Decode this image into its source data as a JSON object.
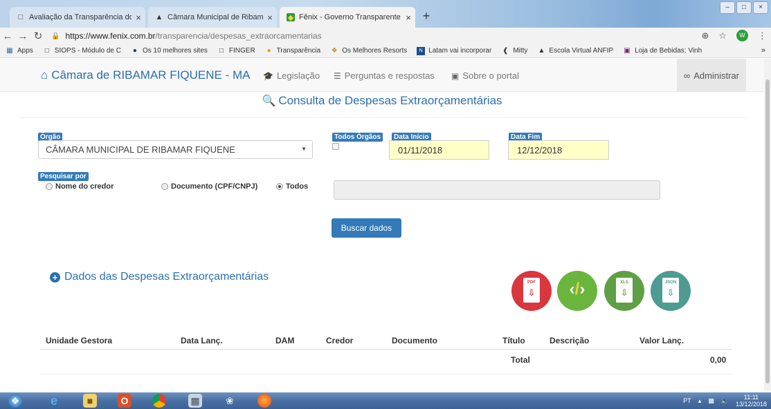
{
  "browser": {
    "tabs": [
      {
        "label": "Avaliação da Transparência dos",
        "active": false
      },
      {
        "label": "Câmara Municipal de Ribamar Fiq",
        "active": false
      },
      {
        "label": "Fênix - Governo Transparente",
        "active": true
      }
    ],
    "url_host": "https://www.fenix.com.br",
    "url_path": "/transparencia/despesas_extraorcamentarias",
    "avatar_letter": "W",
    "bookmarks": [
      "Apps",
      "SIOPS - Módulo de C",
      "Os 10 melhores sites",
      "FINGER",
      "Transparência",
      "Os Melhores Resorts",
      "Latam vai incorporar",
      "Mitty",
      "Escola Virtual ANFIP",
      "Loja de Bebidas: Vinh"
    ],
    "bookmarks_more": "»"
  },
  "site": {
    "brand": "Câmara de RIBAMAR FIQUENE - MA",
    "nav": [
      "Legislação",
      "Perguntas e respostas",
      "Sobre o portal"
    ],
    "admin": "Administrar"
  },
  "page": {
    "title": "Consulta de Despesas Extraorçamentárias",
    "form": {
      "orgao_label": "Órgão",
      "orgao_value": "CÂMARA MUNICIPAL DE RIBAMAR FIQUENE",
      "todos_orgaos_label": "Todos Órgãos",
      "data_inicio_label": "Data Início",
      "data_inicio_value": "01/11/2018",
      "data_fim_label": "Data Fim",
      "data_fim_value": "12/12/2018",
      "pesquisar_por_label": "Pesquisar por",
      "radio_options": [
        "Nome do credor",
        "Documento (CPF/CNPJ)",
        "Todos"
      ],
      "selected_radio": "Todos",
      "search_value": "",
      "buscar_label": "Buscar dados"
    },
    "section_title": "Dados das Despesas Extraorçamentárias",
    "export_icons": [
      {
        "name": "pdf-export-icon",
        "tag": "PDF",
        "color": "#d9363e"
      },
      {
        "name": "code-export-icon",
        "tag": "",
        "color": "#6ab53d"
      },
      {
        "name": "xls-export-icon",
        "tag": "XLS",
        "color": "#5f9f45"
      },
      {
        "name": "json-export-icon",
        "tag": "JSON",
        "color": "#4d9b93"
      }
    ],
    "table": {
      "headers": [
        "Unidade Gestora",
        "Data Lanç.",
        "DAM",
        "Credor",
        "Documento",
        "Título",
        "Descrição",
        "Valor Lanç."
      ],
      "total_label": "Total",
      "total_value": "0,00"
    }
  },
  "taskbar": {
    "lang": "PT",
    "time": "11:11",
    "date": "13/12/2018"
  }
}
